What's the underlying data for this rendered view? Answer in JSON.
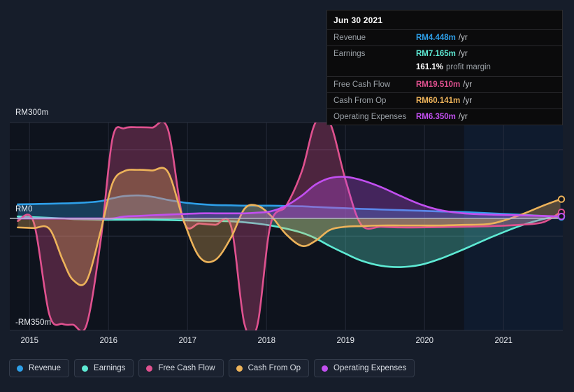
{
  "chart_data": {
    "type": "line",
    "title": "",
    "xlabel": "",
    "ylabel": "",
    "currency_prefix": "RM",
    "ylim": [
      -350,
      300
    ],
    "xlim": [
      2014.75,
      2021.75
    ],
    "grid": true,
    "legend_position": "bottom-left",
    "y_ticks": [
      {
        "value": 300,
        "label": "RM300m"
      },
      {
        "value": 0,
        "label": "RM0"
      },
      {
        "value": -350,
        "label": "-RM350m"
      }
    ],
    "x_ticks": [
      {
        "value": 2015,
        "label": "2015"
      },
      {
        "value": 2016,
        "label": "2016"
      },
      {
        "value": 2017,
        "label": "2017"
      },
      {
        "value": 2018,
        "label": "2018"
      },
      {
        "value": 2019,
        "label": "2019"
      },
      {
        "value": 2020,
        "label": "2020"
      },
      {
        "value": 2021,
        "label": "2021"
      }
    ],
    "x": [
      2014.85,
      2015.05,
      2015.25,
      2015.42,
      2015.55,
      2015.72,
      2015.9,
      2016.05,
      2016.2,
      2016.38,
      2016.55,
      2016.75,
      2016.95,
      2017.15,
      2017.35,
      2017.55,
      2017.72,
      2017.88,
      2018.05,
      2018.25,
      2018.45,
      2018.62,
      2018.8,
      2019.0,
      2019.2,
      2019.45,
      2019.7,
      2019.95,
      2020.2,
      2020.5,
      2020.85,
      2021.2,
      2021.5,
      2021.72
    ],
    "series": [
      {
        "name": "Revenue",
        "color": "#2e9fe8",
        "fill": true,
        "values": [
          44,
          45,
          46,
          47,
          48,
          50,
          54,
          63,
          70,
          72,
          68,
          58,
          50,
          45,
          42,
          41,
          40,
          40,
          40,
          39,
          38,
          36,
          34,
          32,
          30,
          28,
          26,
          24,
          22,
          20,
          16,
          12,
          8,
          4.448
        ]
      },
      {
        "name": "Earnings",
        "color": "#5eead4",
        "fill": true,
        "values": [
          6,
          4,
          2,
          0,
          -2,
          -3,
          -4,
          -4,
          -4,
          -4,
          -4,
          -5,
          -6,
          -7,
          -8,
          -9,
          -12,
          -16,
          -22,
          -32,
          -45,
          -62,
          -86,
          -110,
          -132,
          -148,
          -152,
          -145,
          -126,
          -96,
          -58,
          -24,
          -2,
          7.165
        ]
      },
      {
        "name": "Free Cash Flow",
        "color": "#e0518f",
        "fill": true,
        "values": [
          -8,
          -10,
          -300,
          -330,
          -332,
          -334,
          -70,
          250,
          282,
          285,
          284,
          280,
          -8,
          -16,
          -20,
          -24,
          -330,
          -338,
          -20,
          40,
          150,
          300,
          320,
          120,
          -20,
          -26,
          -28,
          -28,
          -27,
          -26,
          -24,
          -20,
          -12,
          19.51
        ]
      },
      {
        "name": "Cash From Op",
        "color": "#edb35a",
        "fill": true,
        "values": [
          -28,
          -30,
          -32,
          -130,
          -192,
          -196,
          -40,
          110,
          148,
          152,
          150,
          146,
          -6,
          -120,
          -130,
          -60,
          30,
          40,
          10,
          -50,
          -86,
          -70,
          -36,
          -26,
          -24,
          -22,
          -22,
          -22,
          -22,
          -20,
          -16,
          10,
          40,
          60.141
        ]
      },
      {
        "name": "Operating Expenses",
        "color": "#c24ff0",
        "fill": true,
        "values": [
          0,
          0,
          0,
          0,
          0,
          0,
          0,
          0,
          6,
          8,
          10,
          12,
          14,
          16,
          16,
          16,
          16,
          18,
          22,
          40,
          72,
          106,
          126,
          130,
          120,
          98,
          70,
          44,
          26,
          16,
          12,
          10,
          8,
          6.35
        ]
      }
    ],
    "forecast_region": {
      "from": 2020.5,
      "to": 2021.75,
      "shaded": true
    }
  },
  "tooltip": {
    "date": "Jun 30 2021",
    "rows": [
      {
        "label": "Revenue",
        "value": "RM4.448m",
        "unit": "/yr",
        "color": "#2e9fe8"
      },
      {
        "label": "Earnings",
        "value": "RM7.165m",
        "unit": "/yr",
        "color": "#5eead4"
      },
      {
        "label": "Free Cash Flow",
        "value": "RM19.510m",
        "unit": "/yr",
        "color": "#e0518f"
      },
      {
        "label": "Cash From Op",
        "value": "RM60.141m",
        "unit": "/yr",
        "color": "#edb35a"
      },
      {
        "label": "Operating Expenses",
        "value": "RM6.350m",
        "unit": "/yr",
        "color": "#c24ff0"
      }
    ],
    "profit_margin_value": "161.1%",
    "profit_margin_label": "profit margin"
  },
  "legend": {
    "items": [
      {
        "label": "Revenue",
        "color": "#2e9fe8"
      },
      {
        "label": "Earnings",
        "color": "#5eead4"
      },
      {
        "label": "Free Cash Flow",
        "color": "#e0518f"
      },
      {
        "label": "Cash From Op",
        "color": "#edb35a"
      },
      {
        "label": "Operating Expenses",
        "color": "#c24ff0"
      }
    ]
  },
  "colors": {
    "page_background": "#161d2a",
    "plot_background": "#0e131d",
    "forecast_background": "#0f1b2e",
    "gridline": "#2a3140",
    "zero_line": "#b9bec7",
    "text": "#e8ebf0",
    "muted_text": "#9aa0a6"
  }
}
